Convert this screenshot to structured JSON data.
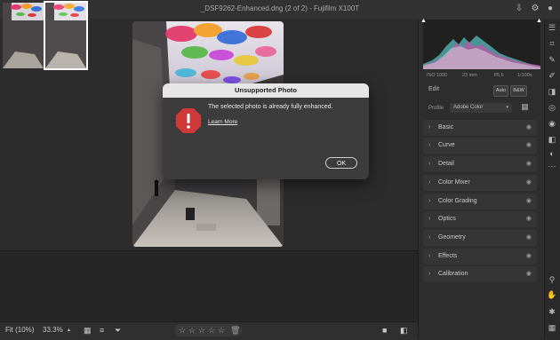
{
  "window": {
    "title": "_DSF9262-Enhanced.dng (2 of 2)  -  Fujifilm X100T"
  },
  "dialog": {
    "title": "Unsupported Photo",
    "message": "The selected photo is already fully enhanced.",
    "link": "Learn More",
    "ok_label": "OK",
    "icon": "warning-icon",
    "icon_color": "#d0393a"
  },
  "histogram": {
    "iso": "ISO 1000",
    "focal": "23 mm",
    "aperture": "f/5.6",
    "shutter": "1/100s"
  },
  "edit_panel": {
    "title": "Edit",
    "auto_label": "Auto",
    "bw_label": "B&W",
    "profile_label": "Profile",
    "profile_value": "Adobe Color",
    "sections": [
      "Basic",
      "Curve",
      "Detail",
      "Color Mixer",
      "Color Grading",
      "Optics",
      "Geometry",
      "Effects",
      "Calibration"
    ]
  },
  "bottom_bar": {
    "fit_label": "Fit (10%)",
    "zoom_label": "33.3%",
    "zoom_arrow": "▴",
    "rating_total": 5
  },
  "colors": {
    "accent": "#d0393a",
    "panel": "#2d2d2d",
    "section": "#353535"
  }
}
